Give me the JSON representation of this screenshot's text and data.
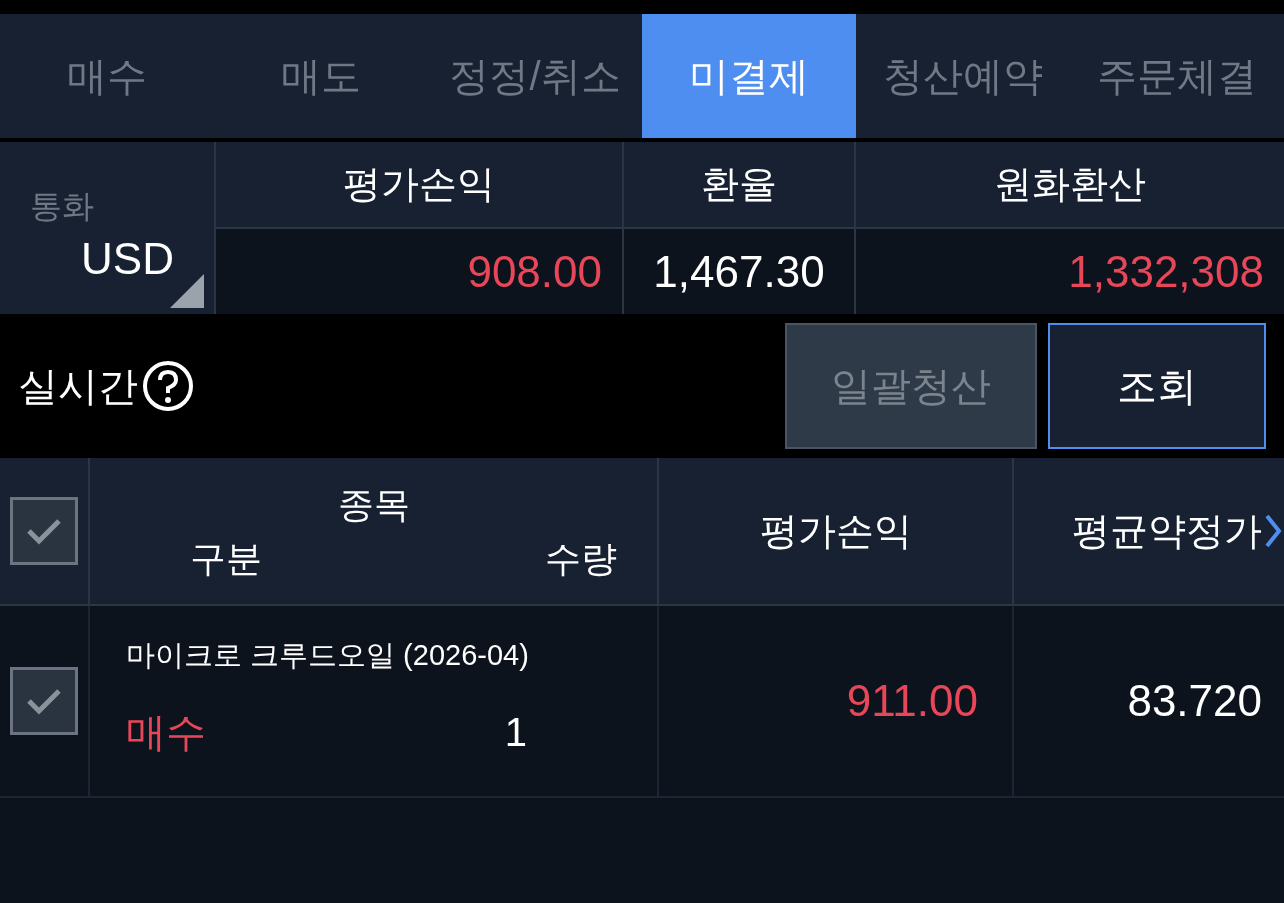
{
  "tabs": [
    {
      "label": "매수",
      "selected": false
    },
    {
      "label": "매도",
      "selected": false
    },
    {
      "label": "정정/취소",
      "selected": false
    },
    {
      "label": "미결제",
      "selected": true
    },
    {
      "label": "청산예약",
      "selected": false
    },
    {
      "label": "주문체결",
      "selected": false
    }
  ],
  "summary": {
    "currency_label": "통화",
    "currency": "USD",
    "columns": [
      {
        "header": "평가손익",
        "value": "908.00",
        "color": "#e8475a"
      },
      {
        "header": "환율",
        "value": "1,467.30",
        "color": "#ffffff"
      },
      {
        "header": "원화환산",
        "value": "1,332,308",
        "color": "#e8475a"
      }
    ]
  },
  "realtime": {
    "label": "실시간"
  },
  "buttons": [
    {
      "label": "일괄청산",
      "disabled": true
    },
    {
      "label": "조회",
      "disabled": false
    }
  ],
  "table": {
    "select_all": {
      "checked": true
    },
    "columns": {
      "top": "종목",
      "left": "구분",
      "right": "수량",
      "pnl": "평가손익",
      "avg": "평균약정가"
    },
    "rows": [
      {
        "checked": true,
        "name": "마이크로 크루드오일 (2026-04)",
        "side": {
          "text": "매수",
          "color": "#e8475a"
        },
        "quantity": "1",
        "pnl": {
          "text": "911.00",
          "color": "#e8475a"
        },
        "avg_price": "83.720"
      }
    ]
  }
}
